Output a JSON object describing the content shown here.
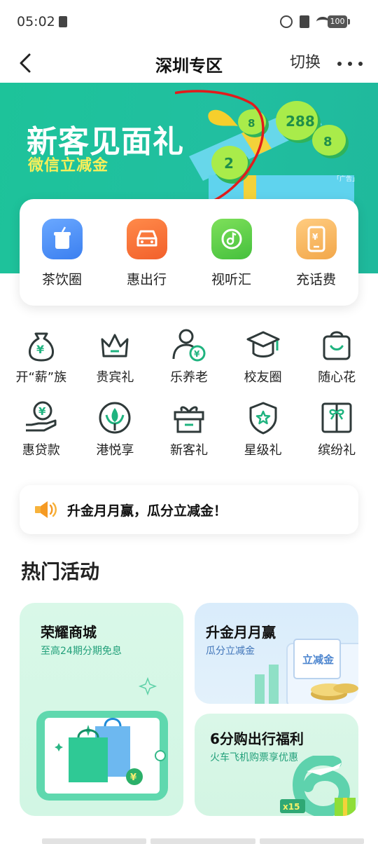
{
  "status_bar": {
    "time": "05:02",
    "battery": "100"
  },
  "header": {
    "title": "深圳专区",
    "switch_label": "切换"
  },
  "banner": {
    "title": "新客见面礼",
    "subtitle": "微信立减金",
    "ad_tag": "「广告」",
    "coins": [
      "288",
      "8",
      "2",
      "8"
    ]
  },
  "quick": [
    {
      "label": "茶饮圈",
      "icon": "cup-icon",
      "color": "#4d8df6"
    },
    {
      "label": "惠出行",
      "icon": "car-icon",
      "color": "#f7743a"
    },
    {
      "label": "视听汇",
      "icon": "music-icon",
      "color": "#5bcc4a"
    },
    {
      "label": "充话费",
      "icon": "phone-bill-icon",
      "color": "#f5b560"
    }
  ],
  "grid": [
    {
      "label": "开“薪”族",
      "icon": "money-bag-icon"
    },
    {
      "label": "贵宾礼",
      "icon": "crown-icon"
    },
    {
      "label": "乐养老",
      "icon": "elder-user-icon"
    },
    {
      "label": "校友圈",
      "icon": "graduation-cap-icon"
    },
    {
      "label": "随心花",
      "icon": "shopping-bag-icon"
    },
    {
      "label": "惠贷款",
      "icon": "loan-hand-icon"
    },
    {
      "label": "港悦享",
      "icon": "bauhinia-icon"
    },
    {
      "label": "新客礼",
      "icon": "gift-box-icon"
    },
    {
      "label": "星级礼",
      "icon": "star-shield-icon"
    },
    {
      "label": "缤纷礼",
      "icon": "ribbon-gift-icon"
    }
  ],
  "notice": {
    "text": "升金月月赢，瓜分立减金！"
  },
  "section": {
    "title": "热门活动"
  },
  "cards": {
    "a": {
      "title": "荣耀商城",
      "subtitle": "至高24期分期免息"
    },
    "b": {
      "title": "升金月月赢",
      "subtitle": "瓜分立减金",
      "ticket": "立减金"
    },
    "c": {
      "title": "6分购出行福利",
      "subtitle": "火车飞机购票享优惠",
      "badge": "x15"
    }
  },
  "colors": {
    "accent": "#21c09c",
    "icon_stroke": "#2f3a3a",
    "icon_accent": "#1fb37f"
  }
}
